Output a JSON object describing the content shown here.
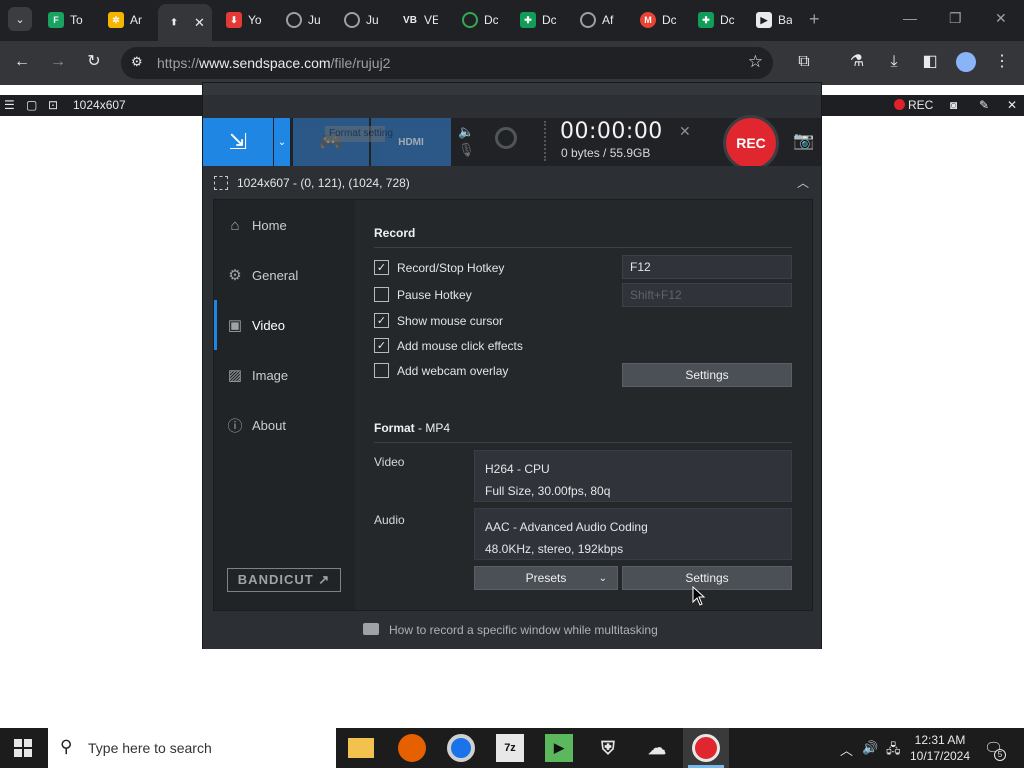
{
  "browser": {
    "tabs": [
      {
        "label": "To",
        "icon": "flow-icon",
        "color": "#1aa260"
      },
      {
        "label": "Ar",
        "icon": "gear-wheel-icon",
        "color": "#f4b400"
      },
      {
        "label": "",
        "icon": "upload-arrow-icon",
        "color": "#9aa0a6",
        "active": true
      },
      {
        "label": "Yo",
        "icon": "download-icon",
        "color": "#e53935"
      },
      {
        "label": "Ju",
        "icon": "globe-icon",
        "color": "#9aa0a6"
      },
      {
        "label": "Ju",
        "icon": "globe-icon",
        "color": "#9aa0a6"
      },
      {
        "label": "VE",
        "icon": "vb-icon",
        "color": "#e8eaed"
      },
      {
        "label": "Dc",
        "icon": "circle-d-icon",
        "color": "#34a853"
      },
      {
        "label": "Dc",
        "icon": "sheet-icon",
        "color": "#0f9d58"
      },
      {
        "label": "Af",
        "icon": "globe-icon",
        "color": "#9aa0a6"
      },
      {
        "label": "Dc",
        "icon": "m-icon",
        "color": "#ea4335"
      },
      {
        "label": "Dc",
        "icon": "sheet-icon",
        "color": "#0f9d58"
      },
      {
        "label": "Ba",
        "icon": "clapper-icon",
        "color": "#e8eaed"
      }
    ],
    "url_prefix": "https://",
    "url_domain": "www.sendspace.com",
    "url_path": "/file/rujuj2"
  },
  "overlay": {
    "size_label": "1024x607",
    "rec_label": "REC"
  },
  "bandicam": {
    "timer": "00:00:00",
    "bytes": "0 bytes / 55.9GB",
    "ghost_title": "Format setting",
    "hdmi_label": "HDMI",
    "rec_button": "REC",
    "area_text": "1024x607 - (0, 121), (1024, 728)",
    "sidebar": [
      {
        "label": "Home",
        "icon": "home-icon"
      },
      {
        "label": "General",
        "icon": "gear-icon"
      },
      {
        "label": "Video",
        "icon": "video-icon",
        "active": true
      },
      {
        "label": "Image",
        "icon": "image-icon"
      },
      {
        "label": "About",
        "icon": "info-icon"
      }
    ],
    "brand": "BANDICUT ↗",
    "record": {
      "title": "Record",
      "options": [
        {
          "label": "Record/Stop Hotkey",
          "checked": true
        },
        {
          "label": "Pause Hotkey",
          "checked": false
        },
        {
          "label": "Show mouse cursor",
          "checked": true
        },
        {
          "label": "Add mouse click effects",
          "checked": true
        },
        {
          "label": "Add webcam overlay",
          "checked": false
        }
      ],
      "hotkey_value": "F12",
      "pause_value": "Shift+F12",
      "settings_label": "Settings"
    },
    "format": {
      "title": "Format",
      "subtitle": "- MP4",
      "video_label": "Video",
      "video_line1": "H264 - CPU",
      "video_line2": "Full Size, 30.00fps, 80q",
      "audio_label": "Audio",
      "audio_line1": "AAC - Advanced Audio Coding",
      "audio_line2": "48.0KHz, stereo, 192kbps",
      "presets_label": "Presets",
      "settings_label": "Settings"
    },
    "tip": "How to record a specific window while multitasking"
  },
  "taskbar": {
    "search_placeholder": "Type here to search",
    "time": "12:31 AM",
    "date": "10/17/2024",
    "notifications": "5"
  },
  "colors": {
    "accent": "#1f86e4",
    "rec": "#e0262f"
  }
}
